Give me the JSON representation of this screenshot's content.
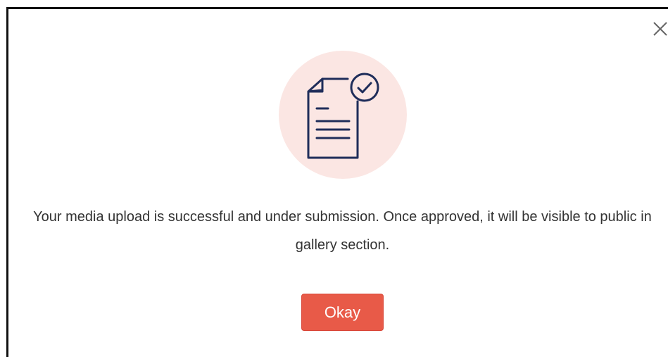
{
  "dialog": {
    "message": "Your media upload is successful and under submission. Once approved, it will be visible to public in gallery section.",
    "ok_label": "Okay",
    "icon": "document-check-icon",
    "close_icon": "close-icon"
  },
  "colors": {
    "accent": "#e85a48",
    "icon_bg": "#fbe6e3",
    "icon_stroke": "#1f2d5a",
    "text": "#333333",
    "border": "#111111"
  }
}
